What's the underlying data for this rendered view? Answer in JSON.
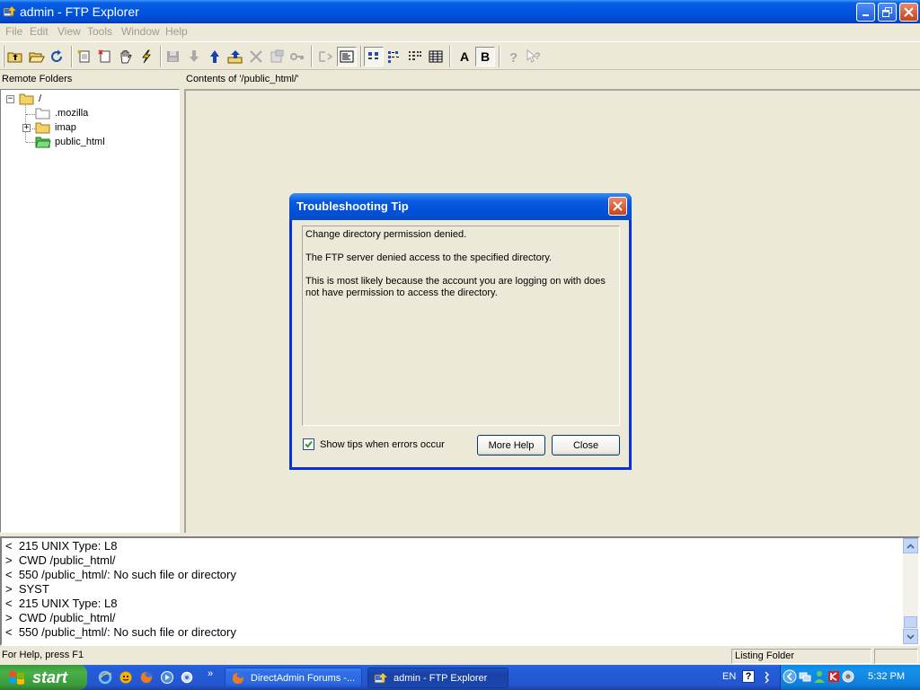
{
  "window": {
    "title": "admin - FTP Explorer"
  },
  "menu": [
    "File",
    "Edit",
    "View",
    "Tools",
    "Window",
    "Help"
  ],
  "panes": {
    "left_header": "Remote Folders",
    "right_header": "Contents of '/public_html/'"
  },
  "tree": {
    "root": "/",
    "items": [
      ".mozilla",
      "imap",
      "public_html"
    ]
  },
  "log": [
    "<  215 UNIX Type: L8",
    ">  CWD /public_html/",
    "<  550 /public_html/: No such file or directory",
    ">  SYST",
    "<  215 UNIX Type: L8",
    ">  CWD /public_html/",
    "<  550 /public_html/: No such file or directory"
  ],
  "status": {
    "help": "For Help, press F1",
    "activity": "Listing Folder"
  },
  "dialog": {
    "title": "Troubleshooting Tip",
    "line1": "Change directory permission denied.",
    "line2": "The FTP server denied access to the specified directory.",
    "line3": "This is most likely because the account you are logging on with does not have permission to access the directory.",
    "checkbox_label": "Show tips when errors occur",
    "checkbox_checked": true,
    "more_help": "More Help",
    "close": "Close"
  },
  "taskbar": {
    "start": "start",
    "tasks": [
      "DirectAdmin Forums -...",
      "admin - FTP Explorer"
    ],
    "language": "EN",
    "clock": "5:32 PM"
  },
  "toolbar": {
    "format_a": "A",
    "format_b": "B"
  },
  "colors": {
    "title_blue": "#0054e3",
    "face": "#ece9d8",
    "taskbar_blue": "#245edb",
    "start_green": "#3c9a3c",
    "tray_blue": "#0f7fdc"
  }
}
